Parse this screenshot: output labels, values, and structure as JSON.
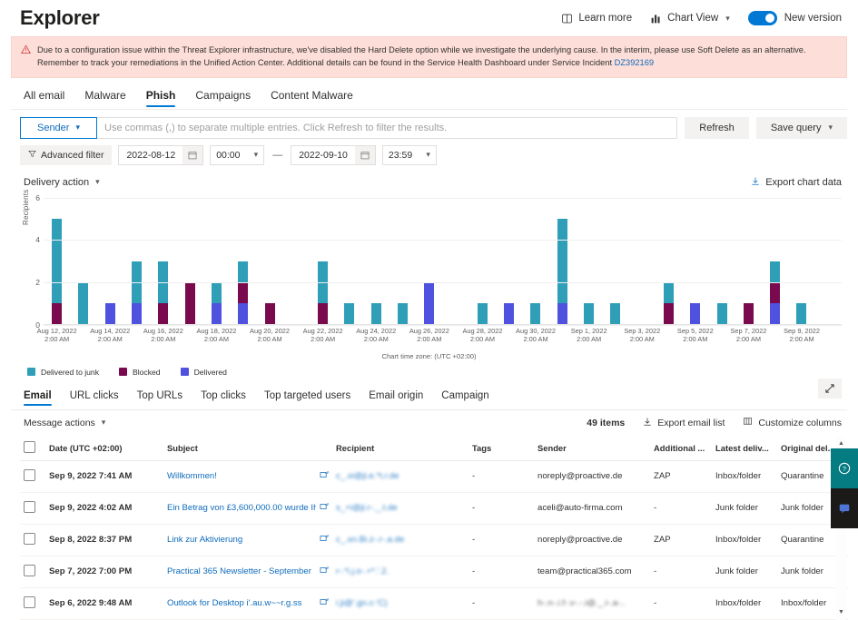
{
  "header": {
    "title": "Explorer",
    "learn_more": "Learn more",
    "learn_more_icon": "book-icon",
    "chart_view": "Chart View",
    "chart_view_icon": "bar-chart-icon",
    "new_version": "New version",
    "toggle_state": "on",
    "accent_color": "#0078d4"
  },
  "banner": {
    "icon": "warning-triangle-icon",
    "text": "Due to a configuration issue within the Threat Explorer infrastructure, we've disabled the Hard Delete option while we investigate the underlying cause. In the interim, please use Soft Delete as an alternative. Remember to track your remediations in the Unified Action Center. Additional details can be found in the Service Health Dashboard under Service Incident ",
    "link": "DZ392169",
    "bg_color": "#fdded8",
    "icon_color": "#d13438"
  },
  "pivot": {
    "items": [
      {
        "label": "All email",
        "active": false
      },
      {
        "label": "Malware",
        "active": false
      },
      {
        "label": "Phish",
        "active": true
      },
      {
        "label": "Campaigns",
        "active": false
      },
      {
        "label": "Content Malware",
        "active": false
      }
    ]
  },
  "filters": {
    "sender_label": "Sender",
    "query_placeholder": "Use commas (,) to separate multiple entries. Click Refresh to filter the results.",
    "refresh_label": "Refresh",
    "save_query_label": "Save query",
    "advanced_filter_label": "Advanced filter",
    "advanced_filter_icon": "funnel-icon",
    "start_date": "2022-08-12",
    "start_time": "00:00",
    "separator": "—",
    "end_date": "2022-09-10",
    "end_time": "23:59",
    "calendar_icon": "calendar-icon"
  },
  "chart_toolbar": {
    "delivery_action": "Delivery action",
    "export_chart_data": "Export chart data",
    "export_icon": "download-icon"
  },
  "chart_data": {
    "type": "bar",
    "stacked": true,
    "title": "",
    "xlabel": "",
    "ylabel": "Recipients",
    "ylim": [
      0,
      6
    ],
    "yticks": [
      0,
      2,
      4,
      6
    ],
    "grid": true,
    "legend_position": "bottom-left",
    "timezone_note": "Chart time zone: (UTC +02:00)",
    "categories": [
      "Aug 12, 2022 2:00 AM",
      "Aug 13, 2022 2:00 AM",
      "Aug 14, 2022 2:00 AM",
      "Aug 15, 2022 2:00 AM",
      "Aug 16, 2022 2:00 AM",
      "Aug 17, 2022 2:00 AM",
      "Aug 18, 2022 2:00 AM",
      "Aug 19, 2022 2:00 AM",
      "Aug 20, 2022 2:00 AM",
      "Aug 21, 2022 2:00 AM",
      "Aug 22, 2022 2:00 AM",
      "Aug 23, 2022 2:00 AM",
      "Aug 24, 2022 2:00 AM",
      "Aug 25, 2022 2:00 AM",
      "Aug 26, 2022 2:00 AM",
      "Aug 27, 2022 2:00 AM",
      "Aug 28, 2022 2:00 AM",
      "Aug 29, 2022 2:00 AM",
      "Aug 30, 2022 2:00 AM",
      "Aug 31, 2022 2:00 AM",
      "Sep 1, 2022 2:00 AM",
      "Sep 2, 2022 2:00 AM",
      "Sep 3, 2022 2:00 AM",
      "Sep 4, 2022 2:00 AM",
      "Sep 5, 2022 2:00 AM",
      "Sep 6, 2022 2:00 AM",
      "Sep 7, 2022 2:00 AM",
      "Sep 8, 2022 2:00 AM",
      "Sep 9, 2022 2:00 AM",
      "Sep 10, 2022 2:00 AM"
    ],
    "tick_labels": [
      "Aug 12, 2022 2:00 AM",
      "Aug 14, 2022 2:00 AM",
      "Aug 16, 2022 2:00 AM",
      "Aug 18, 2022 2:00 AM",
      "Aug 20, 2022 2:00 AM",
      "Aug 22, 2022 2:00 AM",
      "Aug 24, 2022 2:00 AM",
      "Aug 26, 2022 2:00 AM",
      "Aug 28, 2022 2:00 AM",
      "Aug 30, 2022 2:00 AM",
      "Sep 1, 2022 2:00 AM",
      "Sep 3, 2022 2:00 AM",
      "Sep 5, 2022 2:00 AM",
      "Sep 7, 2022 2:00 AM",
      "Sep 9, 2022 2:00 AM"
    ],
    "series": [
      {
        "name": "Delivered",
        "color": "#4f52de",
        "values": [
          0,
          0,
          1,
          1,
          0,
          0,
          1,
          1,
          0,
          0,
          0,
          0,
          0,
          0,
          2,
          0,
          0,
          1,
          0,
          1,
          0,
          0,
          0,
          0,
          1,
          0,
          0,
          1,
          0,
          0
        ]
      },
      {
        "name": "Blocked",
        "color": "#790a4e",
        "values": [
          1,
          0,
          0,
          0,
          1,
          2,
          0,
          1,
          1,
          0,
          1,
          0,
          0,
          0,
          0,
          0,
          0,
          0,
          0,
          0,
          0,
          0,
          0,
          1,
          0,
          0,
          1,
          1,
          0,
          0
        ]
      },
      {
        "name": "Delivered to junk",
        "color": "#2f9fb8",
        "values": [
          4,
          2,
          0,
          2,
          2,
          0,
          1,
          1,
          0,
          0,
          2,
          1,
          1,
          1,
          0,
          0,
          1,
          0,
          1,
          4,
          1,
          1,
          0,
          1,
          0,
          1,
          0,
          1,
          1,
          0
        ]
      }
    ],
    "legend": [
      {
        "label": "Delivered to junk",
        "color": "#2f9fb8"
      },
      {
        "label": "Blocked",
        "color": "#790a4e"
      },
      {
        "label": "Delivered",
        "color": "#4f52de"
      }
    ]
  },
  "lower_pivot": {
    "items": [
      {
        "label": "Email",
        "active": true
      },
      {
        "label": "URL clicks",
        "active": false
      },
      {
        "label": "Top URLs",
        "active": false
      },
      {
        "label": "Top clicks",
        "active": false
      },
      {
        "label": "Top targeted users",
        "active": false
      },
      {
        "label": "Email origin",
        "active": false
      },
      {
        "label": "Campaign",
        "active": false
      }
    ],
    "expand_icon": "expand-diagonal-icon"
  },
  "command_bar": {
    "message_actions": "Message actions",
    "items_count": "49 items",
    "export_email_list": "Export email list",
    "export_icon": "download-icon",
    "customize_columns": "Customize columns",
    "customize_icon": "columns-icon"
  },
  "table": {
    "columns": [
      "Date (UTC +02:00)",
      "Subject",
      "Recipient",
      "Tags",
      "Sender",
      "Additional ...",
      "Latest deliv...",
      "Original del..."
    ],
    "rows": [
      {
        "date": "Sep 9, 2022 7:41 AM",
        "subject": "Willkommen!",
        "recipient": "c_.xi@ji.e.*t.r.de",
        "tags": "-",
        "sender": "noreply@proactive.de",
        "additional": "ZAP",
        "latest": "Inbox/folder",
        "original": "Quarantine"
      },
      {
        "date": "Sep 9, 2022 4:02 AM",
        "subject": "Ein Betrag von £3,600,000.00 wurde Ih",
        "recipient": "s_+i@ji.r-._.t.de",
        "tags": "-",
        "sender": "aceli@auto-firma.com",
        "additional": "-",
        "latest": "Junk folder",
        "original": "Junk folder"
      },
      {
        "date": "Sep 8, 2022 8:37 PM",
        "subject": "Link zur Aktivierung",
        "recipient": "c_.xn.Bi.z-.r-.a.de",
        "tags": "-",
        "sender": "noreply@proactive.de",
        "additional": "ZAP",
        "latest": "Inbox/folder",
        "original": "Quarantine"
      },
      {
        "date": "Sep 7, 2022 7:00 PM",
        "subject": "Practical 365 Newsletter - September",
        "recipient": "r-.*i.j.o-.+*.'.2.",
        "tags": "-",
        "sender": "team@practical365.com",
        "additional": "-",
        "latest": "Junk folder",
        "original": "Junk folder"
      },
      {
        "date": "Sep 6, 2022 9:48 AM",
        "subject": "Outlook for Desktop  i'.au.w~~r.g.ss",
        "recipient": "i.ji@'.gn.c-'C)",
        "tags": "-",
        "sender": "h-.n-.i.f-.v-.-.i@._.i-.a-..",
        "additional": "-",
        "latest": "Inbox/folder",
        "original": "Inbox/folder"
      }
    ]
  }
}
